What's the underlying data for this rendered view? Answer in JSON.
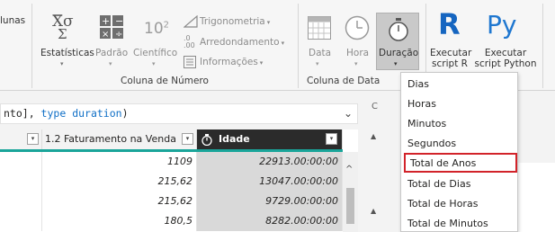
{
  "ribbon": {
    "truncated_left": "lunas",
    "number_group": {
      "statistics": "Estatísticas",
      "standard": "Padrão",
      "scientific": "Científico",
      "trigonometry": "Trigonometria",
      "rounding": "Arredondamento",
      "information": "Informações",
      "label": "Coluna de Número",
      "scientific_icon_text": "10",
      "scientific_icon_exp": "2"
    },
    "date_group": {
      "date": "Data",
      "time": "Hora",
      "duration": "Duração",
      "label": "Coluna de Data"
    },
    "scripts": {
      "r_line1": "Executar",
      "r_line2": "script R",
      "py_line1": "Executar",
      "py_line2": "script Python",
      "r_icon": "R",
      "py_icon": "Py"
    }
  },
  "formula": {
    "prefix": "nto], ",
    "kw1": "type",
    "kw2": "duration",
    "suffix": ")"
  },
  "grid": {
    "col2_header": "1.2 Faturamento na Venda",
    "col3_header": "Idade",
    "rows": [
      {
        "faturamento": "1109",
        "idade": "22913.00:00:00"
      },
      {
        "faturamento": "215,62",
        "idade": "13047.00:00:00"
      },
      {
        "faturamento": "215,62",
        "idade": "9729.00:00:00"
      },
      {
        "faturamento": "180,5",
        "idade": "8282.00:00:00"
      }
    ]
  },
  "duration_menu": {
    "items": [
      "Dias",
      "Horas",
      "Minutos",
      "Segundos",
      "Total de Anos",
      "Total de Dias",
      "Total de Horas",
      "Total de Minutos"
    ],
    "highlighted_index": 4
  },
  "colors": {
    "accent_teal": "#1aa59a",
    "highlight_red": "#d2232a",
    "python_blue": "#1f77d0",
    "r_blue": "#1565c0"
  }
}
